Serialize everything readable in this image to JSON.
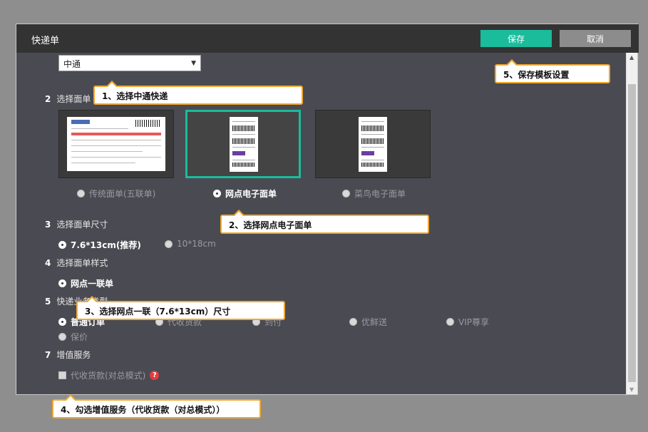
{
  "dialog": {
    "title": "快递单",
    "save_label": "保存",
    "cancel_label": "取消"
  },
  "carrier_select": {
    "value": "中通",
    "arrow": "▼"
  },
  "sections": {
    "s2": {
      "num": "2",
      "label": "选择面单"
    },
    "s3": {
      "num": "3",
      "label": "选择面单尺寸"
    },
    "s4": {
      "num": "4",
      "label": "选择面单样式"
    },
    "s5": {
      "num": "5",
      "label": "快递业务类型"
    },
    "s7": {
      "num": "7",
      "label": "增值服务"
    }
  },
  "sheet_types": [
    {
      "label": "传统面单(五联单)",
      "selected": false
    },
    {
      "label": "网点电子面单",
      "selected": true
    },
    {
      "label": "菜鸟电子面单",
      "selected": false
    }
  ],
  "sizes": [
    {
      "label": "7.6*13cm(推荐)",
      "selected": true
    },
    {
      "label": "10*18cm",
      "selected": false
    }
  ],
  "styles": [
    {
      "label": "网点一联单",
      "selected": true
    }
  ],
  "business_types": [
    {
      "label": "普通订单",
      "selected": true
    },
    {
      "label": "代收货款",
      "selected": false
    },
    {
      "label": "到付",
      "selected": false
    },
    {
      "label": "优鲜送",
      "selected": false
    },
    {
      "label": "VIP尊享",
      "selected": false
    },
    {
      "label": "保价",
      "selected": false
    }
  ],
  "value_added": {
    "label": "代收货款(对总模式)",
    "checked": false,
    "help": "?"
  },
  "callouts": {
    "c1": "1、选择中通快递",
    "c2": "2、选择网点电子面单",
    "c3": "3、选择网点一联（7.6*13cm）尺寸",
    "c4": "4、勾选增值服务（代收货款（对总模式））",
    "c5": "5、保存模板设置"
  },
  "scrollbar": {
    "up": "▲",
    "down": "▼"
  },
  "colors": {
    "accent": "#1abc9c",
    "callout_border": "#f0a830",
    "panel": "#4a4a52",
    "titlebar": "#333333"
  }
}
